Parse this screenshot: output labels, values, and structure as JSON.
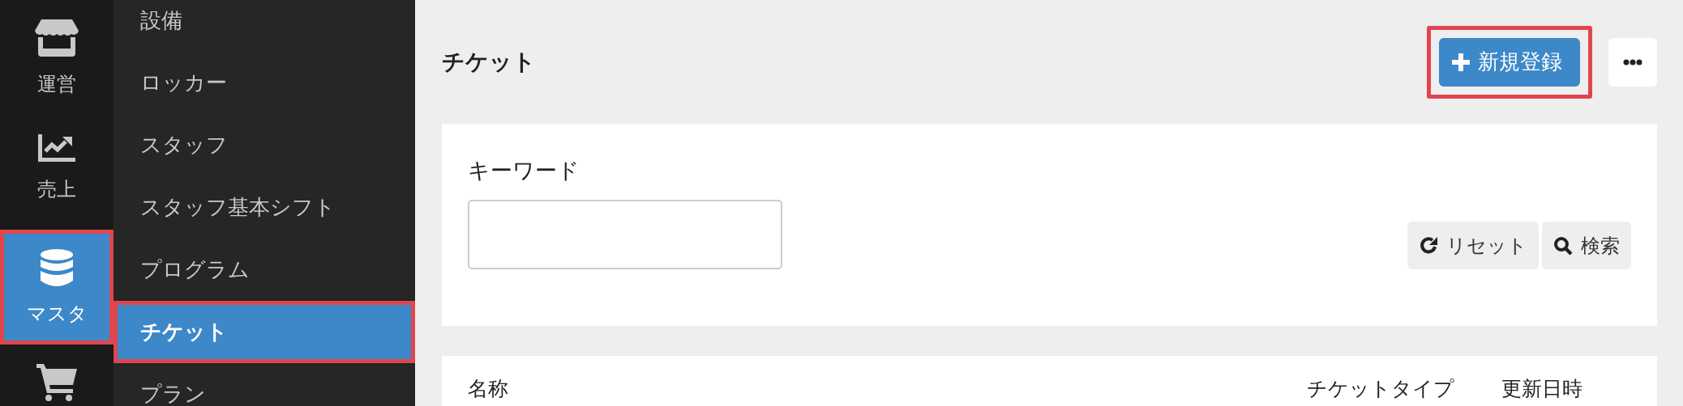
{
  "rail": {
    "items": [
      {
        "label": "運営",
        "selected": false,
        "highlighted": false
      },
      {
        "label": "売上",
        "selected": false,
        "highlighted": false
      },
      {
        "label": "マスタ",
        "selected": true,
        "highlighted": true
      },
      {
        "selected": false,
        "highlighted": false
      }
    ]
  },
  "submenu": {
    "items": [
      {
        "label": "設備",
        "selected": false,
        "highlighted": false
      },
      {
        "label": "ロッカー",
        "selected": false,
        "highlighted": false
      },
      {
        "label": "スタッフ",
        "selected": false,
        "highlighted": false
      },
      {
        "label": "スタッフ基本シフト",
        "selected": false,
        "highlighted": false
      },
      {
        "label": "プログラム",
        "selected": false,
        "highlighted": false
      },
      {
        "label": "チケット",
        "selected": true,
        "highlighted": true
      },
      {
        "label": "プラン",
        "selected": false,
        "highlighted": false
      }
    ]
  },
  "page": {
    "title": "チケット",
    "new_button": {
      "label": "新規登録",
      "highlighted": true
    }
  },
  "search": {
    "keyword_label": "キーワード",
    "reset_button": "リセット",
    "search_button": "検索"
  },
  "table": {
    "columns": [
      "名称",
      "チケットタイプ",
      "更新日時"
    ]
  }
}
